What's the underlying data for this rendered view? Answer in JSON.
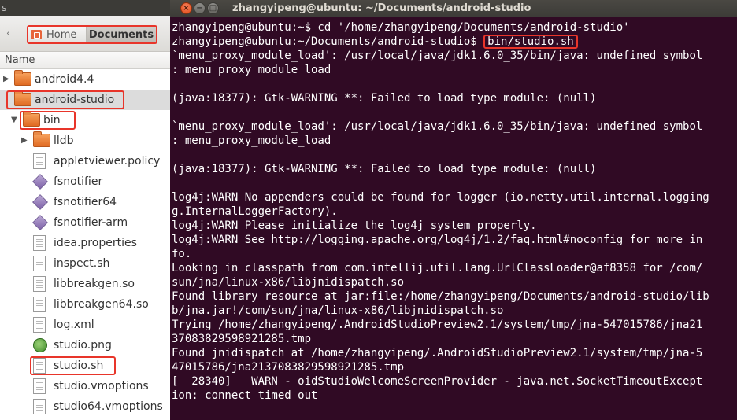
{
  "file_manager": {
    "topbar_text": "s",
    "back_glyph": "‹",
    "breadcrumbs": {
      "home": "Home",
      "current": "Documents"
    },
    "column_header": "Name",
    "items": [
      {
        "label": "android4.4",
        "icon": "folder-icon",
        "expander": "▶",
        "depth": 0,
        "highlight": false,
        "selected": false
      },
      {
        "label": "android-studio",
        "icon": "folder-icon",
        "expander": "",
        "depth": 0,
        "highlight": true,
        "selected": true
      },
      {
        "label": "bin",
        "icon": "folder-icon",
        "expander": "▼",
        "depth": 1,
        "highlight": true,
        "selected": false
      },
      {
        "label": "lldb",
        "icon": "folder-icon",
        "expander": "▶",
        "depth": 2,
        "highlight": false,
        "selected": false
      },
      {
        "label": "appletviewer.policy",
        "icon": "text-file-icon",
        "expander": "",
        "depth": 2,
        "highlight": false,
        "selected": false
      },
      {
        "label": "fsnotifier",
        "icon": "executable-icon",
        "expander": "",
        "depth": 2,
        "highlight": false,
        "selected": false
      },
      {
        "label": "fsnotifier64",
        "icon": "executable-icon",
        "expander": "",
        "depth": 2,
        "highlight": false,
        "selected": false
      },
      {
        "label": "fsnotifier-arm",
        "icon": "executable-icon",
        "expander": "",
        "depth": 2,
        "highlight": false,
        "selected": false
      },
      {
        "label": "idea.properties",
        "icon": "text-file-icon",
        "expander": "",
        "depth": 2,
        "highlight": false,
        "selected": false
      },
      {
        "label": "inspect.sh",
        "icon": "text-file-icon",
        "expander": "",
        "depth": 2,
        "highlight": false,
        "selected": false
      },
      {
        "label": "libbreakgen.so",
        "icon": "text-file-icon",
        "expander": "",
        "depth": 2,
        "highlight": false,
        "selected": false
      },
      {
        "label": "libbreakgen64.so",
        "icon": "text-file-icon",
        "expander": "",
        "depth": 2,
        "highlight": false,
        "selected": false
      },
      {
        "label": "log.xml",
        "icon": "text-file-icon",
        "expander": "",
        "depth": 2,
        "highlight": false,
        "selected": false
      },
      {
        "label": "studio.png",
        "icon": "image-file-icon",
        "expander": "",
        "depth": 2,
        "highlight": false,
        "selected": false
      },
      {
        "label": "studio.sh",
        "icon": "text-file-icon",
        "expander": "",
        "depth": 2,
        "highlight": true,
        "selected": false
      },
      {
        "label": "studio.vmoptions",
        "icon": "text-file-icon",
        "expander": "",
        "depth": 2,
        "highlight": false,
        "selected": false
      },
      {
        "label": "studio64.vmoptions",
        "icon": "text-file-icon",
        "expander": "",
        "depth": 2,
        "highlight": false,
        "selected": false
      }
    ]
  },
  "terminal": {
    "title": "zhangyipeng@ubuntu: ~/Documents/android-studio",
    "buttons": {
      "close": "×",
      "minimize": "−",
      "maximize": "□"
    },
    "lines": [
      {
        "text": "zhangyipeng@ubuntu:~$ cd '/home/zhangyipeng/Documents/android-studio'"
      },
      {
        "prompt": "zhangyipeng@ubuntu:~/Documents/android-studio$ ",
        "command": "bin/studio.sh"
      },
      {
        "text": "`menu_proxy_module_load': /usr/local/java/jdk1.6.0_35/bin/java: undefined symbol"
      },
      {
        "text": ": menu_proxy_module_load"
      },
      {
        "text": ""
      },
      {
        "text": "(java:18377): Gtk-WARNING **: Failed to load type module: (null)"
      },
      {
        "text": ""
      },
      {
        "text": "`menu_proxy_module_load': /usr/local/java/jdk1.6.0_35/bin/java: undefined symbol"
      },
      {
        "text": ": menu_proxy_module_load"
      },
      {
        "text": ""
      },
      {
        "text": "(java:18377): Gtk-WARNING **: Failed to load type module: (null)"
      },
      {
        "text": ""
      },
      {
        "text": "log4j:WARN No appenders could be found for logger (io.netty.util.internal.logging"
      },
      {
        "text": "g.InternalLoggerFactory)."
      },
      {
        "text": "log4j:WARN Please initialize the log4j system properly."
      },
      {
        "text": "log4j:WARN See http://logging.apache.org/log4j/1.2/faq.html#noconfig for more in"
      },
      {
        "text": "fo."
      },
      {
        "text": "Looking in classpath from com.intellij.util.lang.UrlClassLoader@af8358 for /com/"
      },
      {
        "text": "sun/jna/linux-x86/libjnidispatch.so"
      },
      {
        "text": "Found library resource at jar:file:/home/zhangyipeng/Documents/android-studio/lib"
      },
      {
        "text": "b/jna.jar!/com/sun/jna/linux-x86/libjnidispatch.so"
      },
      {
        "text": "Trying /home/zhangyipeng/.AndroidStudioPreview2.1/system/tmp/jna-547015786/jna21"
      },
      {
        "text": "37083829598921285.tmp"
      },
      {
        "text": "Found jnidispatch at /home/zhangyipeng/.AndroidStudioPreview2.1/system/tmp/jna-5"
      },
      {
        "text": "47015786/jna2137083829598921285.tmp"
      },
      {
        "text": "[  28340]   WARN - oidStudioWelcomeScreenProvider - java.net.SocketTimeoutExcept"
      },
      {
        "text": "ion: connect timed out"
      }
    ]
  },
  "colors": {
    "terminal_bg": "#300a24",
    "terminal_text": "#ffffff",
    "highlight_box": "#e8352a",
    "folder": "#e87a34",
    "selection": "#dcdcdc"
  }
}
